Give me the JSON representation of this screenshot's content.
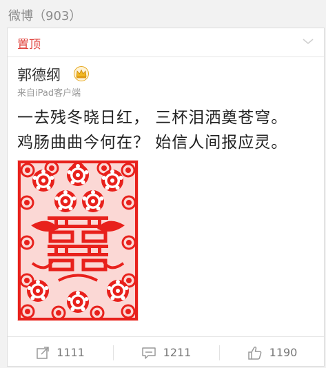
{
  "header": {
    "title": "微博（903）"
  },
  "pin": {
    "label": "置顶"
  },
  "post": {
    "author": "郭德纲",
    "source": "来自iPad客户端",
    "lines": [
      "一去残冬晓日红， 三杯泪洒奠苍穹。",
      "鸡肠曲曲今何在？ 始信人间报应灵。"
    ],
    "image_description": "red double-happiness paper cut"
  },
  "actions": {
    "repost_count": "1111",
    "comment_count": "1211",
    "like_count": "1190"
  },
  "colors": {
    "accent": "#e0413b",
    "paper_red": "#e8211c",
    "crown_gold": "#f2b822"
  }
}
